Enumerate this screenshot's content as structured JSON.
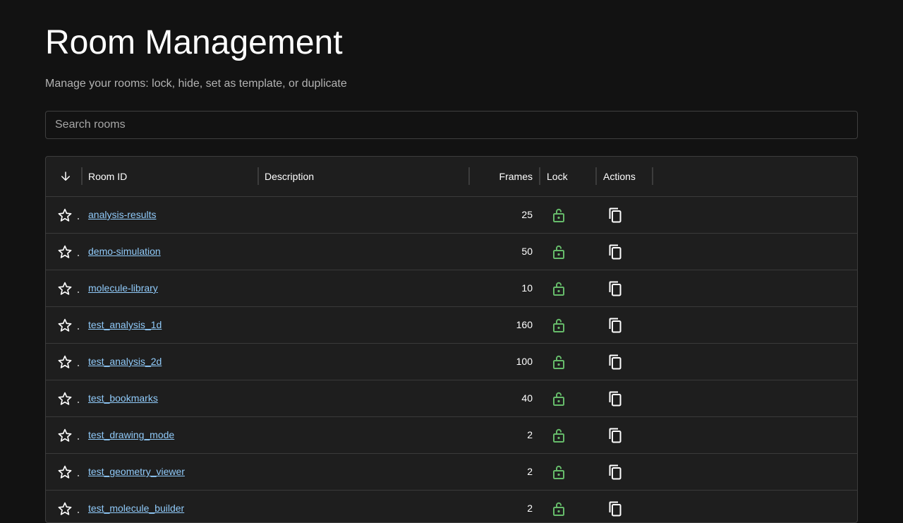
{
  "page": {
    "title": "Room Management",
    "subtitle": "Manage your rooms: lock, hide, set as template, or duplicate"
  },
  "search": {
    "placeholder": "Search rooms",
    "value": ""
  },
  "table": {
    "columns": {
      "room_id": "Room ID",
      "description": "Description",
      "frames": "Frames",
      "lock": "Lock",
      "actions": "Actions"
    },
    "sort_icon": "arrow-down-icon",
    "rows": [
      {
        "room_id": "analysis-results",
        "description": "",
        "frames": "25",
        "locked": false
      },
      {
        "room_id": "demo-simulation",
        "description": "",
        "frames": "50",
        "locked": false
      },
      {
        "room_id": "molecule-library",
        "description": "",
        "frames": "10",
        "locked": false
      },
      {
        "room_id": "test_analysis_1d",
        "description": "",
        "frames": "160",
        "locked": false
      },
      {
        "room_id": "test_analysis_2d",
        "description": "",
        "frames": "100",
        "locked": false
      },
      {
        "room_id": "test_bookmarks",
        "description": "",
        "frames": "40",
        "locked": false
      },
      {
        "room_id": "test_drawing_mode",
        "description": "",
        "frames": "2",
        "locked": false
      },
      {
        "room_id": "test_geometry_viewer",
        "description": "",
        "frames": "2",
        "locked": false
      },
      {
        "room_id": "test_molecule_builder",
        "description": "",
        "frames": "2",
        "locked": false
      }
    ]
  },
  "icons": {
    "star": "star-outline-icon",
    "lock": "lock-open-icon",
    "duplicate": "content-copy-icon"
  },
  "colors": {
    "background": "#121212",
    "surface": "#1e1e1e",
    "link": "#90caf9",
    "unlock": "#66bb6a",
    "border": "#3a3a3a"
  }
}
